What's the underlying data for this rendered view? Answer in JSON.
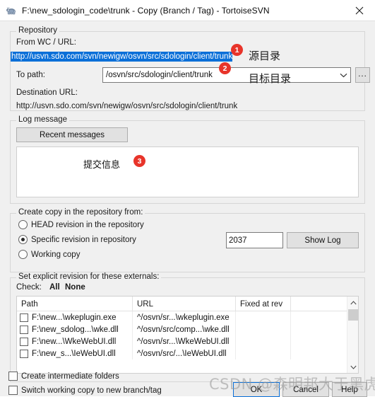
{
  "window": {
    "title": "F:\\new_sdologin_code\\trunk - Copy (Branch / Tag) - TortoiseSVN",
    "icon": "tortoisesvn-turtle-icon",
    "close_label": "✕"
  },
  "repository": {
    "legend": "Repository",
    "from_label": "From WC / URL:",
    "from_url": "http://usvn.sdo.com/svn/newigw/osvn/src/sdologin/client/trunk",
    "to_label": "To path:",
    "to_path": "/osvn/src/sdologin/client/trunk",
    "browse_label": "...",
    "dest_label": "Destination URL:",
    "dest_url": "http://usvn.sdo.com/svn/newigw/osvn/src/sdologin/client/trunk"
  },
  "log_message": {
    "legend": "Log message",
    "recent_button": "Recent messages",
    "message_text": "提交信息"
  },
  "create_copy": {
    "legend": "Create copy in the repository from:",
    "options": [
      {
        "label": "HEAD revision in the repository",
        "checked": false
      },
      {
        "label": "Specific revision in repository",
        "checked": true
      },
      {
        "label": "Working copy",
        "checked": false
      }
    ],
    "revision_value": "2037",
    "show_log_button": "Show Log"
  },
  "externals": {
    "legend": "Set explicit revision for these externals:",
    "check_label": "Check:",
    "check_all": "All",
    "check_none": "None",
    "columns": [
      "Path",
      "URL",
      "Fixed at rev",
      ""
    ],
    "rows": [
      {
        "checked": false,
        "path": "F:\\new...\\wkeplugin.exe",
        "url": "^/osvn/sr...\\wkeplugin.exe",
        "fixed_at_rev": ""
      },
      {
        "checked": false,
        "path": "F:\\new_sdolog...\\wke.dll",
        "url": "^/osvn/src/comp...\\wke.dll",
        "fixed_at_rev": ""
      },
      {
        "checked": false,
        "path": "F:\\new...\\WkeWebUI.dll",
        "url": "^/osvn/sr...\\WkeWebUI.dll",
        "fixed_at_rev": ""
      },
      {
        "checked": false,
        "path": "F:\\new_s...\\IeWebUI.dll",
        "url": "^/osvn/src/...\\IeWebUI.dll",
        "fixed_at_rev": ""
      }
    ]
  },
  "footer": {
    "create_intermediate": "Create intermediate folders",
    "switch_working_copy": "Switch working copy to new branch/tag",
    "ok_button": "OK",
    "cancel_button": "Cancel",
    "help_button": "Help"
  },
  "annotations": {
    "badge1": "1",
    "badge2": "2",
    "badge3": "3",
    "source_dir": "源目录",
    "target_dir": "目标目录"
  },
  "watermark": {
    "text": "CSDN @森明邦大于黑虎邦"
  },
  "colors": {
    "dialog_bg": "#f0f0f0",
    "selection_blue": "#0a6fd8",
    "badge_red": "#e8342a",
    "accent_border": "#0a6fd8"
  }
}
